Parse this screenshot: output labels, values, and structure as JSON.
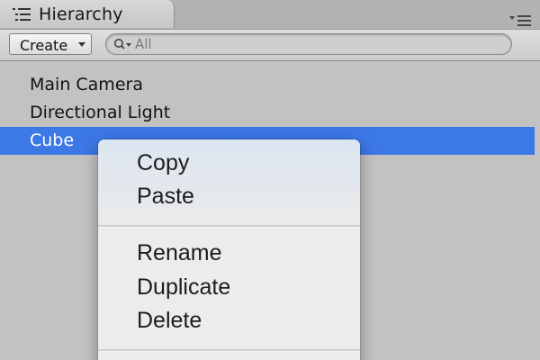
{
  "panel": {
    "title": "Hierarchy",
    "icon": "hierarchy-list-icon",
    "menu_icon": "pane-options-icon"
  },
  "toolbar": {
    "create_label": "Create",
    "search_placeholder": "All",
    "search_value": ""
  },
  "hierarchy": {
    "items": [
      {
        "label": "Main Camera"
      },
      {
        "label": "Directional Light"
      },
      {
        "label": "Cube",
        "selected": true
      }
    ]
  },
  "context_menu": {
    "groups": [
      {
        "items": [
          {
            "label": "Copy"
          },
          {
            "label": "Paste"
          }
        ]
      },
      {
        "items": [
          {
            "label": "Rename"
          },
          {
            "label": "Duplicate"
          },
          {
            "label": "Delete"
          }
        ]
      }
    ]
  },
  "colors": {
    "selection": "#3c78e6",
    "panel_bg": "#c2c2c2",
    "menu_bg": "#ececec"
  }
}
